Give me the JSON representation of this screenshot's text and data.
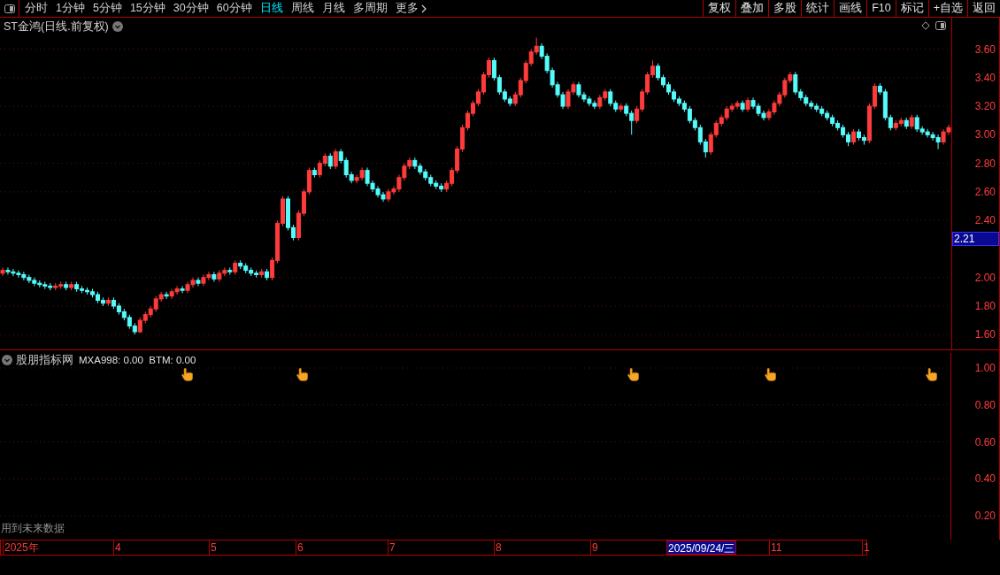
{
  "toolbar": {
    "periods": [
      {
        "label": "分时",
        "selected": false
      },
      {
        "label": "1分钟",
        "selected": false
      },
      {
        "label": "5分钟",
        "selected": false
      },
      {
        "label": "15分钟",
        "selected": false
      },
      {
        "label": "30分钟",
        "selected": false
      },
      {
        "label": "60分钟",
        "selected": false
      },
      {
        "label": "日线",
        "selected": true
      },
      {
        "label": "周线",
        "selected": false
      },
      {
        "label": "月线",
        "selected": false
      },
      {
        "label": "多周期",
        "selected": false
      },
      {
        "label": "更多",
        "selected": false
      }
    ],
    "buttons": [
      "复权",
      "叠加",
      "多股",
      "统计",
      "画线",
      "F10",
      "标记",
      "+自选",
      "返回"
    ]
  },
  "chart": {
    "title": "ST金鸿(日线.前复权)",
    "price_marker": "2.21",
    "chart_data": {
      "type": "candlestick",
      "ylim": [
        1.49,
        3.82
      ],
      "grid": true,
      "categories": [
        null,
        null,
        null,
        null,
        null,
        null,
        null,
        null,
        null,
        null,
        null,
        null,
        null,
        null,
        null,
        null,
        null,
        null,
        null,
        null,
        null,
        null,
        null,
        null,
        null,
        null,
        null,
        null,
        null,
        null,
        null,
        null,
        null,
        null,
        null,
        null,
        null,
        null,
        null,
        null,
        null,
        null,
        null,
        null,
        null,
        null,
        null,
        null,
        null,
        null,
        null,
        null,
        null,
        null,
        null,
        null,
        null,
        null,
        null,
        null,
        null,
        null,
        null,
        null,
        null,
        null,
        null,
        null,
        null,
        null,
        null,
        null,
        null,
        null,
        null,
        null,
        null,
        null,
        null,
        null,
        null,
        null,
        null,
        null,
        null,
        null,
        null,
        null,
        null,
        null,
        null,
        null,
        null,
        null,
        null,
        null,
        null,
        null,
        null,
        null,
        null,
        null,
        null,
        null,
        null,
        null,
        null,
        null,
        null,
        null,
        null,
        null,
        null,
        null,
        null,
        null,
        null,
        null,
        null,
        null,
        null,
        null,
        null,
        null,
        null,
        null,
        null,
        null,
        null,
        null,
        null,
        null,
        null,
        null,
        null,
        null,
        null,
        null,
        null,
        null,
        null,
        null,
        null,
        null,
        null,
        null,
        null,
        null,
        null,
        null,
        null,
        null,
        null,
        null,
        null,
        null,
        null,
        null,
        null,
        null,
        null,
        null,
        null,
        null,
        null,
        null,
        null,
        null,
        null,
        null,
        null,
        null,
        null,
        null,
        null,
        null,
        null,
        null,
        null,
        null
      ],
      "yticks": [
        {
          "value": 3.6,
          "label": "3.60"
        },
        {
          "value": 3.4,
          "label": "3.40"
        },
        {
          "value": 3.2,
          "label": "3.20"
        },
        {
          "value": 3.0,
          "label": "3.00"
        },
        {
          "value": 2.8,
          "label": "2.80"
        },
        {
          "value": 2.6,
          "label": "2.60"
        },
        {
          "value": 2.4,
          "label": "2.40"
        },
        {
          "value": 2.0,
          "label": "2.00"
        },
        {
          "value": 1.8,
          "label": "1.80"
        },
        {
          "value": 1.6,
          "label": "1.60"
        }
      ],
      "ohlc": [
        [
          2.03,
          2.07,
          2.01,
          2.05
        ],
        [
          2.05,
          2.07,
          2.02,
          2.04
        ],
        [
          2.04,
          2.06,
          2.01,
          2.03
        ],
        [
          2.03,
          2.05,
          2.0,
          2.02
        ],
        [
          2.02,
          2.04,
          1.98,
          2.0
        ],
        [
          2.0,
          2.02,
          1.96,
          1.98
        ],
        [
          1.98,
          2.0,
          1.94,
          1.96
        ],
        [
          1.96,
          1.98,
          1.93,
          1.95
        ],
        [
          1.95,
          1.97,
          1.92,
          1.94
        ],
        [
          1.94,
          1.96,
          1.91,
          1.93
        ],
        [
          1.93,
          1.96,
          1.91,
          1.94
        ],
        [
          1.94,
          1.97,
          1.92,
          1.95
        ],
        [
          1.95,
          1.97,
          1.91,
          1.93
        ],
        [
          1.93,
          1.97,
          1.91,
          1.95
        ],
        [
          1.95,
          1.97,
          1.9,
          1.92
        ],
        [
          1.92,
          1.94,
          1.89,
          1.91
        ],
        [
          1.91,
          1.93,
          1.88,
          1.9
        ],
        [
          1.9,
          1.92,
          1.86,
          1.88
        ],
        [
          1.88,
          1.9,
          1.82,
          1.84
        ],
        [
          1.84,
          1.86,
          1.8,
          1.82
        ],
        [
          1.82,
          1.86,
          1.8,
          1.84
        ],
        [
          1.84,
          1.86,
          1.78,
          1.8
        ],
        [
          1.8,
          1.82,
          1.74,
          1.76
        ],
        [
          1.76,
          1.78,
          1.7,
          1.72
        ],
        [
          1.72,
          1.74,
          1.64,
          1.66
        ],
        [
          1.66,
          1.68,
          1.6,
          1.62
        ],
        [
          1.62,
          1.72,
          1.61,
          1.7
        ],
        [
          1.7,
          1.76,
          1.68,
          1.74
        ],
        [
          1.74,
          1.8,
          1.72,
          1.78
        ],
        [
          1.78,
          1.87,
          1.76,
          1.85
        ],
        [
          1.85,
          1.9,
          1.83,
          1.88
        ],
        [
          1.88,
          1.9,
          1.85,
          1.87
        ],
        [
          1.87,
          1.92,
          1.85,
          1.9
        ],
        [
          1.9,
          1.94,
          1.88,
          1.92
        ],
        [
          1.92,
          1.94,
          1.89,
          1.91
        ],
        [
          1.91,
          1.97,
          1.89,
          1.95
        ],
        [
          1.95,
          2.0,
          1.93,
          1.98
        ],
        [
          1.98,
          2.0,
          1.94,
          1.96
        ],
        [
          1.96,
          2.02,
          1.94,
          2.0
        ],
        [
          2.0,
          2.04,
          1.98,
          2.02
        ],
        [
          2.02,
          2.04,
          1.97,
          1.99
        ],
        [
          1.99,
          2.05,
          1.97,
          2.03
        ],
        [
          2.03,
          2.07,
          2.01,
          2.05
        ],
        [
          2.05,
          2.07,
          2.02,
          2.04
        ],
        [
          2.04,
          2.12,
          2.02,
          2.1
        ],
        [
          2.1,
          2.12,
          2.06,
          2.08
        ],
        [
          2.08,
          2.1,
          2.03,
          2.05
        ],
        [
          2.05,
          2.07,
          2.01,
          2.03
        ],
        [
          2.03,
          2.05,
          2.0,
          2.02
        ],
        [
          2.02,
          2.06,
          2.0,
          2.04
        ],
        [
          2.04,
          2.06,
          1.98,
          2.0
        ],
        [
          2.0,
          2.14,
          1.98,
          2.12
        ],
        [
          2.12,
          2.4,
          2.1,
          2.38
        ],
        [
          2.38,
          2.57,
          2.36,
          2.55
        ],
        [
          2.55,
          2.57,
          2.33,
          2.35
        ],
        [
          2.35,
          2.37,
          2.26,
          2.28
        ],
        [
          2.28,
          2.47,
          2.26,
          2.45
        ],
        [
          2.45,
          2.62,
          2.43,
          2.6
        ],
        [
          2.6,
          2.77,
          2.58,
          2.75
        ],
        [
          2.75,
          2.77,
          2.7,
          2.72
        ],
        [
          2.72,
          2.82,
          2.7,
          2.8
        ],
        [
          2.8,
          2.87,
          2.78,
          2.85
        ],
        [
          2.85,
          2.87,
          2.76,
          2.78
        ],
        [
          2.78,
          2.9,
          2.76,
          2.88
        ],
        [
          2.88,
          2.9,
          2.8,
          2.82
        ],
        [
          2.82,
          2.84,
          2.7,
          2.72
        ],
        [
          2.72,
          2.74,
          2.66,
          2.68
        ],
        [
          2.68,
          2.72,
          2.66,
          2.7
        ],
        [
          2.7,
          2.77,
          2.68,
          2.75
        ],
        [
          2.75,
          2.77,
          2.64,
          2.66
        ],
        [
          2.66,
          2.68,
          2.6,
          2.62
        ],
        [
          2.62,
          2.64,
          2.56,
          2.58
        ],
        [
          2.58,
          2.6,
          2.53,
          2.55
        ],
        [
          2.55,
          2.62,
          2.53,
          2.6
        ],
        [
          2.6,
          2.64,
          2.58,
          2.62
        ],
        [
          2.62,
          2.72,
          2.6,
          2.7
        ],
        [
          2.7,
          2.8,
          2.68,
          2.78
        ],
        [
          2.78,
          2.84,
          2.76,
          2.82
        ],
        [
          2.82,
          2.84,
          2.76,
          2.78
        ],
        [
          2.78,
          2.8,
          2.72,
          2.74
        ],
        [
          2.74,
          2.76,
          2.68,
          2.7
        ],
        [
          2.7,
          2.72,
          2.64,
          2.66
        ],
        [
          2.66,
          2.68,
          2.62,
          2.64
        ],
        [
          2.64,
          2.66,
          2.6,
          2.62
        ],
        [
          2.62,
          2.68,
          2.6,
          2.66
        ],
        [
          2.66,
          2.77,
          2.64,
          2.75
        ],
        [
          2.75,
          2.92,
          2.73,
          2.9
        ],
        [
          2.9,
          3.07,
          2.88,
          3.05
        ],
        [
          3.05,
          3.17,
          3.03,
          3.15
        ],
        [
          3.15,
          3.24,
          3.13,
          3.22
        ],
        [
          3.22,
          3.32,
          3.2,
          3.3
        ],
        [
          3.3,
          3.44,
          3.28,
          3.42
        ],
        [
          3.42,
          3.54,
          3.4,
          3.52
        ],
        [
          3.52,
          3.54,
          3.38,
          3.4
        ],
        [
          3.4,
          3.42,
          3.28,
          3.3
        ],
        [
          3.3,
          3.32,
          3.23,
          3.25
        ],
        [
          3.25,
          3.27,
          3.2,
          3.22
        ],
        [
          3.22,
          3.3,
          3.2,
          3.28
        ],
        [
          3.28,
          3.4,
          3.26,
          3.38
        ],
        [
          3.38,
          3.52,
          3.36,
          3.5
        ],
        [
          3.5,
          3.6,
          3.48,
          3.58
        ],
        [
          3.58,
          3.68,
          3.56,
          3.62
        ],
        [
          3.62,
          3.64,
          3.53,
          3.55
        ],
        [
          3.55,
          3.57,
          3.43,
          3.45
        ],
        [
          3.45,
          3.47,
          3.33,
          3.35
        ],
        [
          3.35,
          3.37,
          3.26,
          3.28
        ],
        [
          3.28,
          3.3,
          3.18,
          3.2
        ],
        [
          3.2,
          3.32,
          3.18,
          3.3
        ],
        [
          3.3,
          3.37,
          3.28,
          3.35
        ],
        [
          3.35,
          3.37,
          3.26,
          3.28
        ],
        [
          3.28,
          3.3,
          3.23,
          3.25
        ],
        [
          3.25,
          3.27,
          3.2,
          3.22
        ],
        [
          3.22,
          3.24,
          3.18,
          3.2
        ],
        [
          3.2,
          3.28,
          3.18,
          3.26
        ],
        [
          3.26,
          3.32,
          3.24,
          3.3
        ],
        [
          3.3,
          3.32,
          3.2,
          3.22
        ],
        [
          3.22,
          3.24,
          3.16,
          3.18
        ],
        [
          3.18,
          3.22,
          3.16,
          3.2
        ],
        [
          3.2,
          3.22,
          3.13,
          3.15
        ],
        [
          3.15,
          3.17,
          3.0,
          3.1
        ],
        [
          3.1,
          3.2,
          3.08,
          3.18
        ],
        [
          3.18,
          3.32,
          3.16,
          3.3
        ],
        [
          3.3,
          3.44,
          3.28,
          3.42
        ],
        [
          3.42,
          3.52,
          3.4,
          3.48
        ],
        [
          3.48,
          3.5,
          3.38,
          3.4
        ],
        [
          3.4,
          3.42,
          3.33,
          3.35
        ],
        [
          3.35,
          3.37,
          3.28,
          3.3
        ],
        [
          3.3,
          3.32,
          3.23,
          3.25
        ],
        [
          3.25,
          3.27,
          3.2,
          3.22
        ],
        [
          3.22,
          3.24,
          3.16,
          3.18
        ],
        [
          3.18,
          3.2,
          3.08,
          3.1
        ],
        [
          3.1,
          3.12,
          3.03,
          3.05
        ],
        [
          3.05,
          3.07,
          2.93,
          2.95
        ],
        [
          2.95,
          2.97,
          2.84,
          2.88
        ],
        [
          2.88,
          3.02,
          2.86,
          3.0
        ],
        [
          3.0,
          3.1,
          2.98,
          3.08
        ],
        [
          3.08,
          3.14,
          3.06,
          3.12
        ],
        [
          3.12,
          3.2,
          3.1,
          3.18
        ],
        [
          3.18,
          3.22,
          3.16,
          3.2
        ],
        [
          3.2,
          3.24,
          3.18,
          3.22
        ],
        [
          3.22,
          3.24,
          3.16,
          3.18
        ],
        [
          3.18,
          3.26,
          3.16,
          3.24
        ],
        [
          3.24,
          3.26,
          3.18,
          3.2
        ],
        [
          3.2,
          3.22,
          3.13,
          3.15
        ],
        [
          3.15,
          3.17,
          3.1,
          3.12
        ],
        [
          3.12,
          3.18,
          3.1,
          3.16
        ],
        [
          3.16,
          3.24,
          3.14,
          3.22
        ],
        [
          3.22,
          3.3,
          3.2,
          3.28
        ],
        [
          3.28,
          3.4,
          3.26,
          3.38
        ],
        [
          3.38,
          3.44,
          3.36,
          3.42
        ],
        [
          3.42,
          3.44,
          3.28,
          3.3
        ],
        [
          3.3,
          3.32,
          3.24,
          3.26
        ],
        [
          3.26,
          3.28,
          3.2,
          3.22
        ],
        [
          3.22,
          3.24,
          3.18,
          3.2
        ],
        [
          3.2,
          3.22,
          3.16,
          3.18
        ],
        [
          3.18,
          3.2,
          3.13,
          3.15
        ],
        [
          3.15,
          3.17,
          3.1,
          3.12
        ],
        [
          3.12,
          3.14,
          3.06,
          3.08
        ],
        [
          3.08,
          3.1,
          3.03,
          3.05
        ],
        [
          3.05,
          3.07,
          2.98,
          3.0
        ],
        [
          3.0,
          3.02,
          2.92,
          2.95
        ],
        [
          2.95,
          3.04,
          2.93,
          3.02
        ],
        [
          3.02,
          3.04,
          2.96,
          2.98
        ],
        [
          2.98,
          3.0,
          2.93,
          2.96
        ],
        [
          2.96,
          3.22,
          2.94,
          3.2
        ],
        [
          3.2,
          3.36,
          3.18,
          3.34
        ],
        [
          3.34,
          3.36,
          3.28,
          3.3
        ],
        [
          3.3,
          3.32,
          3.1,
          3.12
        ],
        [
          3.12,
          3.14,
          3.03,
          3.05
        ],
        [
          3.05,
          3.1,
          3.03,
          3.08
        ],
        [
          3.08,
          3.12,
          3.06,
          3.1
        ],
        [
          3.1,
          3.12,
          3.04,
          3.06
        ],
        [
          3.06,
          3.14,
          3.04,
          3.12
        ],
        [
          3.12,
          3.14,
          3.02,
          3.04
        ],
        [
          3.04,
          3.06,
          3.0,
          3.02
        ],
        [
          3.02,
          3.04,
          2.98,
          3.0
        ],
        [
          3.0,
          3.02,
          2.96,
          2.98
        ],
        [
          2.98,
          3.0,
          2.9,
          2.95
        ],
        [
          2.95,
          3.04,
          2.93,
          3.02
        ],
        [
          3.02,
          3.07,
          3.0,
          3.05
        ]
      ]
    }
  },
  "indicator": {
    "title": "股朋指标网",
    "values": "MXA998: 0.00  BTM: 0.00",
    "y_ticks": [
      "1.00",
      "0.80",
      "0.60",
      "0.40",
      "0.20"
    ]
  },
  "footer_note": "用到未来数据",
  "date_axis": [
    {
      "label": "2025年",
      "selected": false
    },
    {
      "label": "4",
      "selected": false
    },
    {
      "label": "5",
      "selected": false
    },
    {
      "label": "6",
      "selected": false
    },
    {
      "label": "7",
      "selected": false
    },
    {
      "label": "8",
      "selected": false
    },
    {
      "label": "9",
      "selected": false
    },
    {
      "label": "2025/09/24/三",
      "selected": true
    },
    {
      "label": "11",
      "selected": false
    },
    {
      "label": "1",
      "selected": false
    }
  ]
}
